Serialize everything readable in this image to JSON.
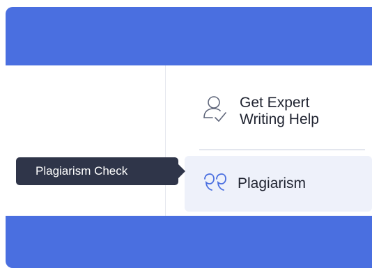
{
  "menu": {
    "items": [
      {
        "label": "Get Expert\nWriting Help",
        "icon": "user-check-icon"
      },
      {
        "label": "Plagiarism",
        "icon": "quote-icon"
      }
    ]
  },
  "tooltip": {
    "text": "Plagiarism Check"
  },
  "colors": {
    "banner": "#4a6fe0",
    "tooltip_bg": "#2f3549",
    "active_bg": "#eef1fa",
    "icon_accent": "#4a6fe0"
  }
}
